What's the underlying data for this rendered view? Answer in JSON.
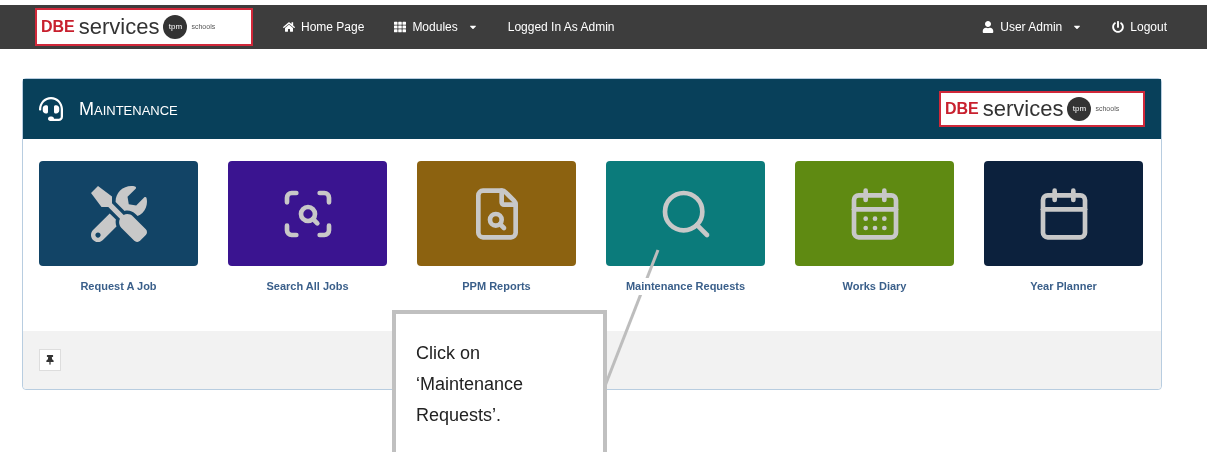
{
  "navbar": {
    "logo": {
      "brand": "DBE",
      "name": "services",
      "badge": "tpm",
      "tagline": "schools"
    },
    "items": [
      {
        "kind": "home",
        "label": "Home Page"
      },
      {
        "kind": "modules",
        "label": "Modules",
        "dropdown": true
      },
      {
        "kind": "text",
        "label": "Logged In As Admin"
      }
    ],
    "right_items": [
      {
        "kind": "user",
        "label": "User Admin",
        "dropdown": true
      },
      {
        "kind": "logout",
        "label": "Logout"
      }
    ]
  },
  "panel": {
    "title": "Maintenance",
    "logo": {
      "brand": "DBE",
      "name": "services",
      "badge": "tpm",
      "tagline": "schools"
    },
    "tiles": [
      {
        "kind": "tools",
        "label": "Request A Job",
        "color": "#124466"
      },
      {
        "kind": "doc-search",
        "label": "Search All Jobs",
        "color": "#3a1490"
      },
      {
        "kind": "report",
        "label": "PPM Reports",
        "color": "#8c6210"
      },
      {
        "kind": "search",
        "label": "Maintenance Requests",
        "color": "#0b7b7b"
      },
      {
        "kind": "calendar-grid",
        "label": "Works Diary",
        "color": "#5f8a12"
      },
      {
        "kind": "calendar",
        "label": "Year Planner",
        "color": "#0c213d"
      }
    ]
  },
  "callout": {
    "text": "Click on ‘Maintenance Requests’."
  }
}
